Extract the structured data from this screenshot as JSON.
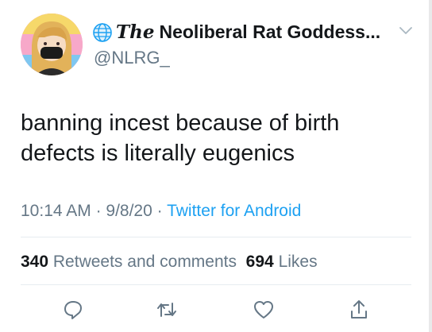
{
  "tweet": {
    "display_name_prefix": "The",
    "display_name": "Neoliberal Rat Goddess...",
    "handle": "@NLRG_",
    "text": "banning incest because of birth\ndefects is literally eugenics",
    "time": "10:14 AM",
    "date": "9/8/20",
    "source": "Twitter for Android",
    "retweets_count": "340",
    "retweets_label": "Retweets and comments",
    "likes_count": "694",
    "likes_label": "Likes"
  },
  "colors": {
    "text": "#14171a",
    "secondary": "#657786",
    "link": "#1da1f2",
    "divider": "#e6ecf0"
  },
  "icons": [
    "globe-icon",
    "chevron-down-icon",
    "reply-icon",
    "retweet-icon",
    "like-icon",
    "share-icon"
  ]
}
